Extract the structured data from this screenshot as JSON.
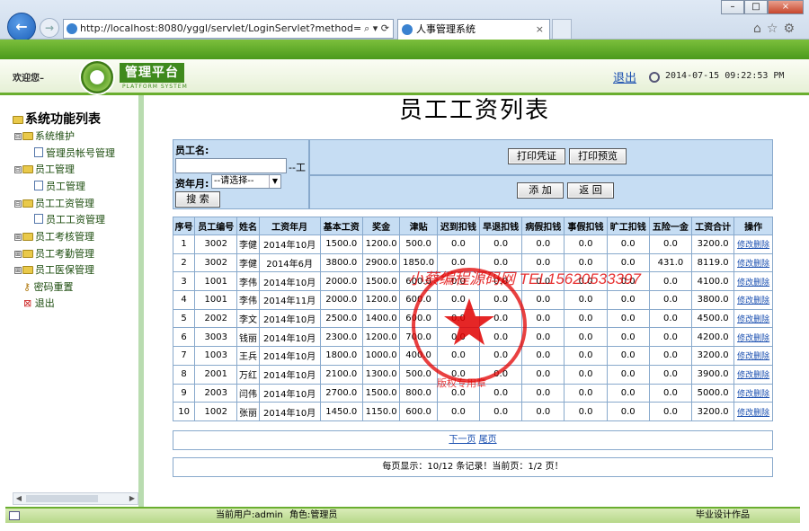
{
  "browser": {
    "url": "http://localhost:8080/yggl/servlet/LoginServlet?method=lo",
    "url_tools": "⌕ ▾ ⟳",
    "tab_title": "人事管理系统",
    "tab_close": "×",
    "nav_back": "←",
    "nav_forward": "→",
    "window_controls": [
      "–",
      "□",
      "×"
    ],
    "right_tools": "⌂☆⚙"
  },
  "header": {
    "welcome": "欢迎您–",
    "logo_title": "管理平台",
    "logo_subtitle": "PLATFORM SYSTEM",
    "logout": "退出",
    "datetime": "2014-07-15 09:22:53 PM"
  },
  "sidebar": {
    "title": "系统功能列表",
    "items": [
      {
        "label": "系统维护",
        "type": "folder",
        "toggle": "⊟"
      },
      {
        "label": "管理员帐号管理",
        "type": "doc"
      },
      {
        "label": "员工管理",
        "type": "folder",
        "toggle": "⊟"
      },
      {
        "label": "员工管理",
        "type": "doc"
      },
      {
        "label": "员工工资管理",
        "type": "folder",
        "toggle": "⊟"
      },
      {
        "label": "员工工资管理",
        "type": "doc"
      },
      {
        "label": "员工考核管理",
        "type": "folder",
        "toggle": "⊞"
      },
      {
        "label": "员工考勤管理",
        "type": "folder",
        "toggle": "⊞"
      },
      {
        "label": "员工医保管理",
        "type": "folder",
        "toggle": "⊞"
      },
      {
        "label": "密码重置",
        "type": "key"
      },
      {
        "label": "退出",
        "type": "exit"
      }
    ],
    "scroll_left": "◀",
    "scroll_right": "▶"
  },
  "main": {
    "title": "员工工资列表"
  },
  "search": {
    "name_label": "员工名:",
    "name_value": "",
    "dash": "--工",
    "month_label": "资年月:",
    "month_select": "--请选择--",
    "select_arrow": "▼",
    "search_btn": "搜 索",
    "print_voucher": "打印凭证",
    "print_preview": "打印预览",
    "add": "添 加",
    "back": "返 回"
  },
  "table": {
    "headers": [
      "序号",
      "员工编号",
      "姓名",
      "工资年月",
      "基本工资",
      "奖金",
      "津贴",
      "迟到扣钱",
      "早退扣钱",
      "病假扣钱",
      "事假扣钱",
      "旷工扣钱",
      "五险一金",
      "工资合计",
      "操作"
    ],
    "rows": [
      [
        "1",
        "3002",
        "李健",
        "2014年10月",
        "1500.0",
        "1200.0",
        "500.0",
        "0.0",
        "0.0",
        "0.0",
        "0.0",
        "0.0",
        "0.0",
        "3200.0"
      ],
      [
        "2",
        "3002",
        "李健",
        "2014年6月",
        "3800.0",
        "2900.0",
        "1850.0",
        "0.0",
        "0.0",
        "0.0",
        "0.0",
        "0.0",
        "431.0",
        "8119.0"
      ],
      [
        "3",
        "1001",
        "李伟",
        "2014年10月",
        "2000.0",
        "1500.0",
        "600.0",
        "0.0",
        "0.0",
        "0.0",
        "0.0",
        "0.0",
        "0.0",
        "4100.0"
      ],
      [
        "4",
        "1001",
        "李伟",
        "2014年11月",
        "2000.0",
        "1200.0",
        "600.0",
        "0.0",
        "0.0",
        "0.0",
        "0.0",
        "0.0",
        "0.0",
        "3800.0"
      ],
      [
        "5",
        "2002",
        "李文",
        "2014年10月",
        "2500.0",
        "1400.0",
        "600.0",
        "0.0",
        "0.0",
        "0.0",
        "0.0",
        "0.0",
        "0.0",
        "4500.0"
      ],
      [
        "6",
        "3003",
        "钱丽",
        "2014年10月",
        "2300.0",
        "1200.0",
        "700.0",
        "0.0",
        "0.0",
        "0.0",
        "0.0",
        "0.0",
        "0.0",
        "4200.0"
      ],
      [
        "7",
        "1003",
        "王兵",
        "2014年10月",
        "1800.0",
        "1000.0",
        "400.0",
        "0.0",
        "0.0",
        "0.0",
        "0.0",
        "0.0",
        "0.0",
        "3200.0"
      ],
      [
        "8",
        "2001",
        "万红",
        "2014年10月",
        "2100.0",
        "1300.0",
        "500.0",
        "0.0",
        "0.0",
        "0.0",
        "0.0",
        "0.0",
        "0.0",
        "3900.0"
      ],
      [
        "9",
        "2003",
        "闫伟",
        "2014年10月",
        "2700.0",
        "1500.0",
        "800.0",
        "0.0",
        "0.0",
        "0.0",
        "0.0",
        "0.0",
        "0.0",
        "5000.0"
      ],
      [
        "10",
        "1002",
        "张丽",
        "2014年10月",
        "1450.0",
        "1150.0",
        "600.0",
        "0.0",
        "0.0",
        "0.0",
        "0.0",
        "0.0",
        "0.0",
        "3200.0"
      ]
    ],
    "edit_label": "修改",
    "delete_label": "删除"
  },
  "pager": {
    "next": "下一页",
    "last": "尾页",
    "info": "每页显示：10/12 条记录！当前页：1/2 页！"
  },
  "footer": {
    "user": "当前用户:admin",
    "role": "角色:管理员",
    "right": "毕业设计作品"
  },
  "watermark": {
    "text": "小蔡编程源码网 TEL15620533397",
    "small": "版权专用章"
  },
  "colors": {
    "accent_green": "#6aae2f",
    "table_header": "#c6ddf3",
    "link": "#1a4fb0",
    "stamp_red": "#e00000"
  }
}
